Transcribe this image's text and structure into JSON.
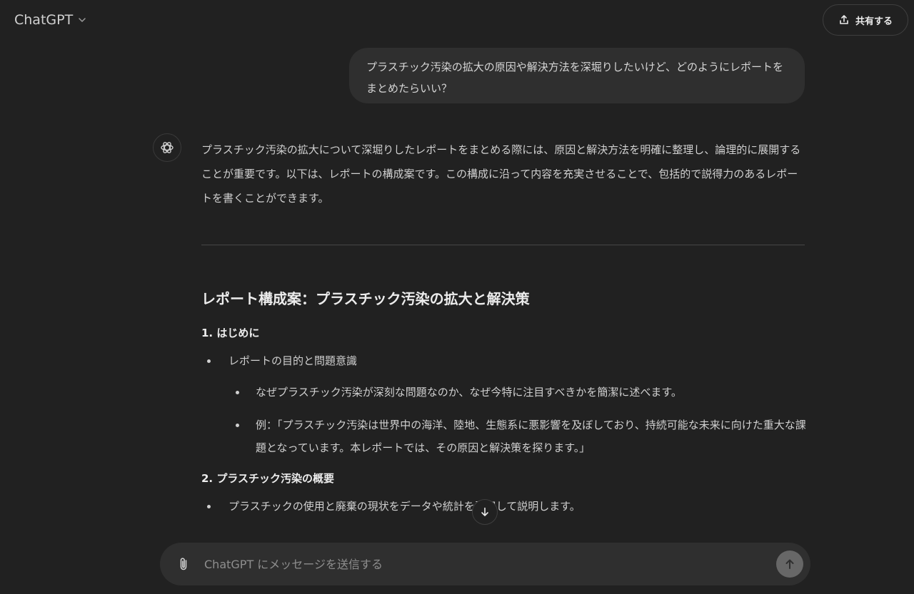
{
  "header": {
    "model_name": "ChatGPT",
    "share_label": "共有する"
  },
  "user_message": {
    "text": "プラスチック汚染の拡大の原因や解決方法を深堀りしたいけど、どのようにレポートをまとめたらいい？"
  },
  "assistant": {
    "intro": "プラスチック汚染の拡大について深堀りしたレポートをまとめる際には、原因と解決方法を明確に整理し、論理的に展開することが重要です。以下は、レポートの構成案です。この構成に沿って内容を充実させることで、包括的で説得力のあるレポートを書くことができます。",
    "report_title": "レポート構成案：プラスチック汚染の拡大と解決策",
    "sections": [
      {
        "heading": "1. はじめに",
        "item": "レポートの目的と問題意識",
        "subitems": [
          "なぜプラスチック汚染が深刻な問題なのか、なぜ今特に注目すべきかを簡潔に述べます。",
          "例：「プラスチック汚染は世界中の海洋、陸地、生態系に悪影響を及ぼしており、持続可能な未来に向けた重大な課題となっています。本レポートでは、その原因と解決策を探ります。」"
        ]
      },
      {
        "heading": "2. プラスチック汚染の概要",
        "item": "プラスチックの使用と廃棄の現状をデータや統計を引用して説明します。"
      }
    ]
  },
  "composer": {
    "placeholder": "ChatGPT にメッセージを送信する"
  }
}
